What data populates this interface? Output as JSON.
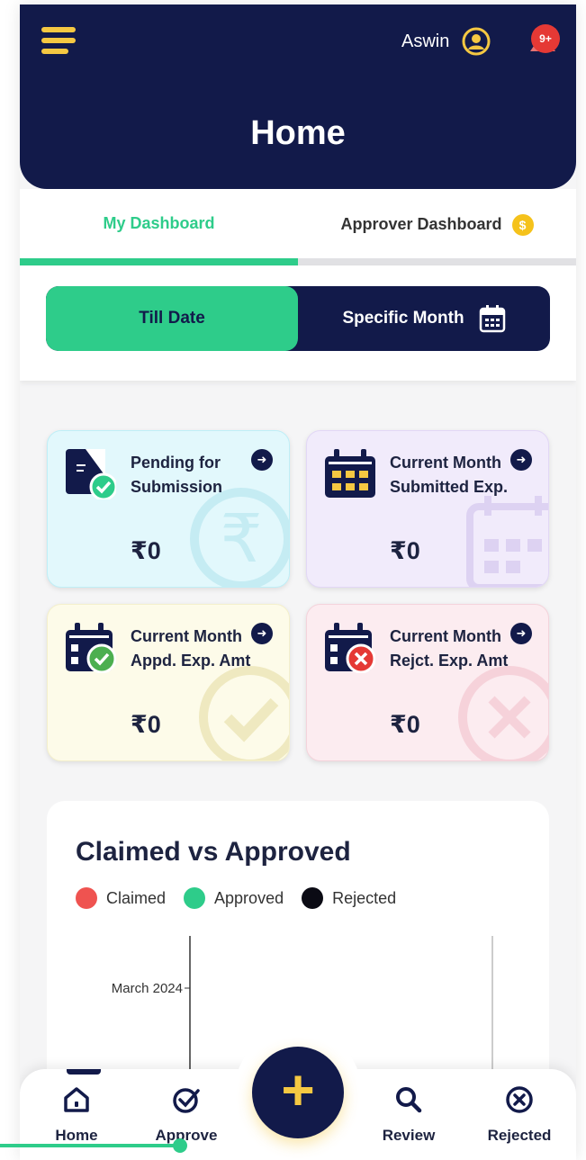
{
  "header": {
    "user_name": "Aswin",
    "notification_badge": "9+",
    "title": "Home",
    "menu_icon": "hamburger-icon",
    "user_icon": "user-circle-icon",
    "notification_icon": "bell-icon"
  },
  "tabs": [
    {
      "label": "My Dashboard",
      "active": true
    },
    {
      "label": "Approver Dashboard",
      "coin_symbol": "$"
    }
  ],
  "toggle": {
    "till_date": "Till Date",
    "specific_month": "Specific Month",
    "calendar_icon": "calendar-icon"
  },
  "cards": [
    {
      "label": "Pending for Submission",
      "amount": "₹0",
      "icon": "document-check-icon",
      "color": "#e2f8fc"
    },
    {
      "label": "Current Month Submitted Exp.",
      "amount": "₹0",
      "icon": "calendar-icon",
      "color": "#f1ebfb"
    },
    {
      "label": "Current Month Appd. Exp. Amt",
      "amount": "₹0",
      "icon": "calendar-check-icon",
      "color": "#fdfbe9"
    },
    {
      "label": "Current Month Rejct. Exp. Amt",
      "amount": "₹0",
      "icon": "calendar-x-icon",
      "color": "#fcecf0"
    }
  ],
  "chart_section": {
    "title": "Claimed vs Approved",
    "legend": [
      {
        "label": "Claimed",
        "color": "#ef5350"
      },
      {
        "label": "Approved",
        "color": "#2ecc8a"
      },
      {
        "label": "Rejected",
        "color": "#0b0b14"
      }
    ]
  },
  "chart_data": {
    "type": "bar",
    "categories": [
      "March 2024"
    ],
    "series": [
      {
        "name": "Claimed",
        "values": [
          0
        ]
      },
      {
        "name": "Approved",
        "values": [
          0
        ]
      },
      {
        "name": "Rejected",
        "values": [
          0
        ]
      }
    ],
    "title": "Claimed vs Approved",
    "legend_position": "top-left"
  },
  "bottom_nav": [
    {
      "label": "Home",
      "icon": "home-icon"
    },
    {
      "label": "Approve",
      "icon": "check-circle-icon"
    },
    {
      "label": "Review",
      "icon": "search-icon"
    },
    {
      "label": "Rejected",
      "icon": "x-circle-icon"
    }
  ],
  "fab_icon": "plus-icon",
  "colors": {
    "navy": "#121a4a",
    "green": "#2ecc8a",
    "yellow": "#f5c842"
  }
}
